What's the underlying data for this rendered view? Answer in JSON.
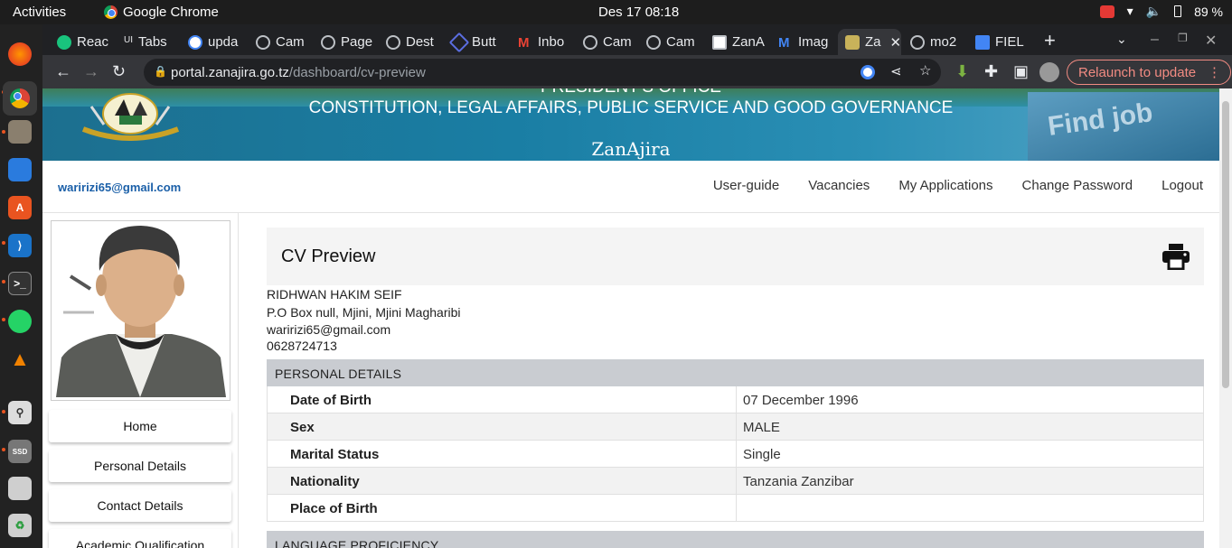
{
  "system": {
    "activities": "Activities",
    "app_name": "Google Chrome",
    "clock": "Des 17  08:18",
    "battery": "89 %"
  },
  "tabs": [
    {
      "label": "Reac"
    },
    {
      "label": "Tabs"
    },
    {
      "label": "upda"
    },
    {
      "label": "Cam"
    },
    {
      "label": "Page"
    },
    {
      "label": "Dest"
    },
    {
      "label": "Butt"
    },
    {
      "label": "Inbo"
    },
    {
      "label": "Cam"
    },
    {
      "label": "Cam"
    },
    {
      "label": "ZanA"
    },
    {
      "label": "Imag"
    },
    {
      "label": "Za"
    },
    {
      "label": "mo2"
    },
    {
      "label": "FIEL"
    }
  ],
  "browser": {
    "url_host": "portal.zanajira.go.tz",
    "url_path": "/dashboard/cv-preview",
    "relaunch": "Relaunch to update"
  },
  "banner": {
    "office_line1": "PRESIDENT'S OFFICE",
    "office_line2": "CONSTITUTION, LEGAL AFFAIRS, PUBLIC SERVICE AND GOOD GOVERNANCE",
    "brand": "ZanAjira",
    "find_job": "Find job"
  },
  "nav": {
    "email": "waririzi65@gmail.com",
    "links": [
      "User-guide",
      "Vacancies",
      "My Applications",
      "Change Password",
      "Logout"
    ]
  },
  "sidebar": {
    "items": [
      "Home",
      "Personal Details",
      "Contact Details",
      "Academic Qualification"
    ]
  },
  "cv": {
    "title": "CV Preview",
    "name": "RIDHWAN HAKIM SEIF",
    "address": "P.O Box null, Mjini, Mjini Magharibi",
    "email": "waririzi65@gmail.com",
    "phone": "0628724713",
    "personal_header": "PERSONAL DETAILS",
    "personal": [
      {
        "label": "Date of Birth",
        "value": "07 December 1996"
      },
      {
        "label": "Sex",
        "value": "MALE"
      },
      {
        "label": "Marital Status",
        "value": "Single"
      },
      {
        "label": "Nationality",
        "value": "Tanzania Zanzibar"
      },
      {
        "label": "Place of Birth",
        "value": ""
      }
    ],
    "language_header": "LANGUAGE PROFICIENCY"
  },
  "colors": {
    "accent_link": "#1a5fa8",
    "section_bg": "#c9ccd1",
    "banner": "#1a7ea4"
  }
}
